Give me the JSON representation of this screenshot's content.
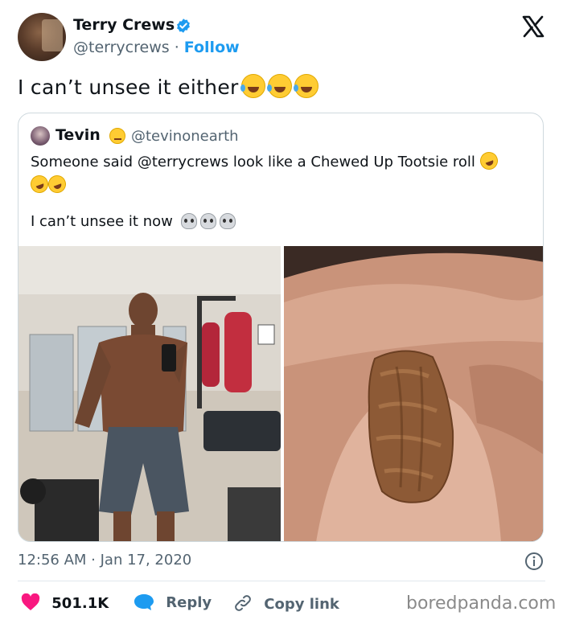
{
  "author": {
    "name": "Terry Crews",
    "handle": "@terrycrews",
    "separator": "·",
    "follow_label": "Follow"
  },
  "tweet": {
    "text": "I can’t unsee it either"
  },
  "quoted": {
    "name": "Tevin",
    "handle": "@tevinonearth",
    "text_line1": "Someone said @terrycrews look like a Chewed Up Tootsie roll",
    "text_line3": "I can’t unsee it now"
  },
  "meta": {
    "timestamp": "12:56 AM · Jan 17, 2020"
  },
  "actions": {
    "likes": "501.1K",
    "reply_label": "Reply",
    "copy_link_label": "Copy link"
  },
  "watermark": "boredpanda.com",
  "colors": {
    "accent": "#1d9bf0",
    "like": "#f91880",
    "text": "#0f1419",
    "muted": "#536471"
  },
  "icons": [
    "verified-badge-icon",
    "x-logo-icon",
    "info-icon",
    "heart-icon",
    "reply-bubble-icon",
    "link-icon"
  ]
}
